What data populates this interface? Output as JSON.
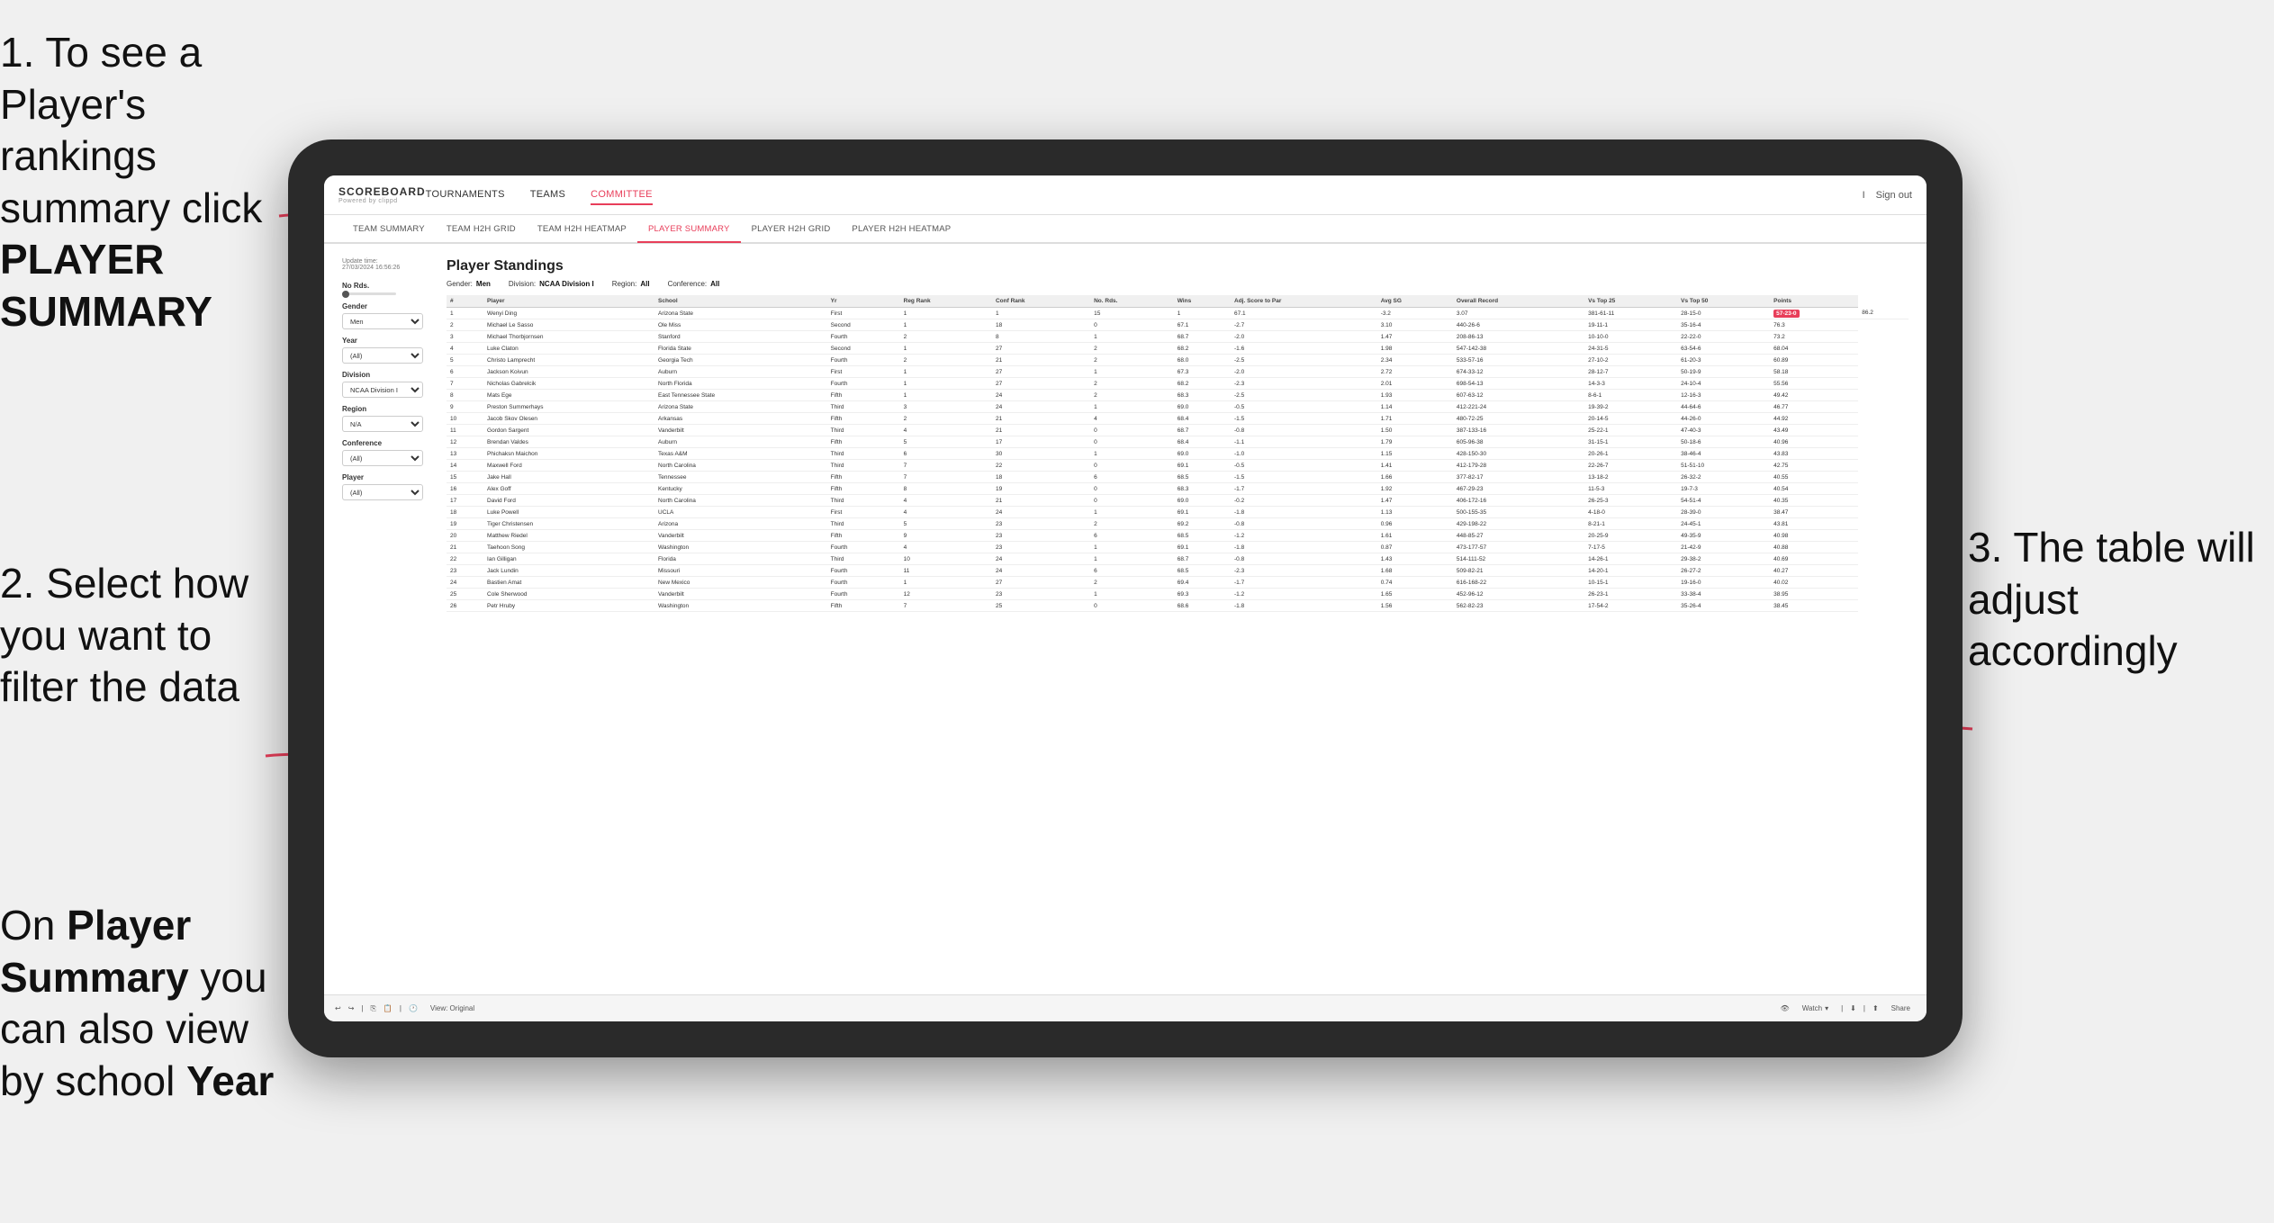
{
  "instructions": {
    "step1": "1. To see a Player's rankings summary click ",
    "step1_bold": "PLAYER SUMMARY",
    "step2_line1": "2. Select how you want to",
    "step2_line2": "filter the data",
    "step4_line1": "On ",
    "step4_bold1": "Player Summary",
    "step4_line2": " you can also view by school ",
    "step4_bold2": "Year",
    "step3_line1": "3. The table will",
    "step3_line2": "adjust accordingly"
  },
  "nav": {
    "logo": "SCOREBOARD",
    "logo_sub": "Powered by clippd",
    "items": [
      "TOURNAMENTS",
      "TEAMS",
      "COMMITTEE"
    ],
    "right_items": [
      "I",
      "Sign out"
    ]
  },
  "subnav": {
    "items": [
      "TEAM SUMMARY",
      "TEAM H2H GRID",
      "TEAM H2H HEATMAP",
      "PLAYER SUMMARY",
      "PLAYER H2H GRID",
      "PLAYER H2H HEATMAP"
    ],
    "active": "PLAYER SUMMARY"
  },
  "update_time": "Update time:\n27/03/2024 16:56:26",
  "filters": {
    "no_rds_label": "No Rds.",
    "gender_label": "Gender",
    "gender_value": "Men",
    "year_label": "Year",
    "year_value": "(All)",
    "division_label": "Division",
    "division_value": "NCAA Division I",
    "region_label": "Region",
    "region_value": "N/A",
    "conference_label": "Conference",
    "conference_value": "(All)",
    "player_label": "Player",
    "player_value": "(All)"
  },
  "table": {
    "title": "Player Standings",
    "gender": "Men",
    "division": "NCAA Division I",
    "region": "All",
    "conference": "All",
    "columns": [
      "#",
      "Player",
      "School",
      "Yr",
      "Reg Rank",
      "Conf Rank",
      "No. Rds.",
      "Wins",
      "Adj. Score to Par",
      "Avg SG",
      "Overall Record",
      "Vs Top 25",
      "Vs Top 50",
      "Points"
    ],
    "rows": [
      [
        "1",
        "Wenyi Ding",
        "Arizona State",
        "First",
        "1",
        "1",
        "15",
        "1",
        "67.1",
        "-3.2",
        "3.07",
        "381-61-11",
        "28-15-0",
        "57-23-0",
        "86.2"
      ],
      [
        "2",
        "Michael Le Sasso",
        "Ole Miss",
        "Second",
        "1",
        "18",
        "0",
        "67.1",
        "-2.7",
        "3.10",
        "440-26-6",
        "19-11-1",
        "35-16-4",
        "76.3"
      ],
      [
        "3",
        "Michael Thorbjornsen",
        "Stanford",
        "Fourth",
        "2",
        "8",
        "1",
        "68.7",
        "-2.0",
        "1.47",
        "208-86-13",
        "10-10-0",
        "22-22-0",
        "73.2"
      ],
      [
        "4",
        "Luke Claton",
        "Florida State",
        "Second",
        "1",
        "27",
        "2",
        "68.2",
        "-1.6",
        "1.98",
        "547-142-38",
        "24-31-5",
        "63-54-6",
        "68.04"
      ],
      [
        "5",
        "Christo Lamprecht",
        "Georgia Tech",
        "Fourth",
        "2",
        "21",
        "2",
        "68.0",
        "-2.5",
        "2.34",
        "533-57-16",
        "27-10-2",
        "61-20-3",
        "60.89"
      ],
      [
        "6",
        "Jackson Koivun",
        "Auburn",
        "First",
        "1",
        "27",
        "1",
        "67.3",
        "-2.0",
        "2.72",
        "674-33-12",
        "28-12-7",
        "50-19-9",
        "58.18"
      ],
      [
        "7",
        "Nicholas Gabrelcik",
        "North Florida",
        "Fourth",
        "1",
        "27",
        "2",
        "68.2",
        "-2.3",
        "2.01",
        "698-54-13",
        "14-3-3",
        "24-10-4",
        "55.56"
      ],
      [
        "8",
        "Mats Ege",
        "East Tennessee State",
        "Fifth",
        "1",
        "24",
        "2",
        "68.3",
        "-2.5",
        "1.93",
        "607-63-12",
        "8-6-1",
        "12-16-3",
        "49.42"
      ],
      [
        "9",
        "Preston Summerhays",
        "Arizona State",
        "Third",
        "3",
        "24",
        "1",
        "69.0",
        "-0.5",
        "1.14",
        "412-221-24",
        "19-39-2",
        "44-64-6",
        "46.77"
      ],
      [
        "10",
        "Jacob Skov Olesen",
        "Arkansas",
        "Fifth",
        "2",
        "21",
        "4",
        "68.4",
        "-1.5",
        "1.71",
        "480-72-25",
        "20-14-5",
        "44-26-0",
        "44.92"
      ],
      [
        "11",
        "Gordon Sargent",
        "Vanderbilt",
        "Third",
        "4",
        "21",
        "0",
        "68.7",
        "-0.8",
        "1.50",
        "387-133-16",
        "25-22-1",
        "47-40-3",
        "43.49"
      ],
      [
        "12",
        "Brendan Valdes",
        "Auburn",
        "Fifth",
        "5",
        "17",
        "0",
        "68.4",
        "-1.1",
        "1.79",
        "605-96-38",
        "31-15-1",
        "50-18-6",
        "40.96"
      ],
      [
        "13",
        "Phichaksn Maichon",
        "Texas A&M",
        "Third",
        "6",
        "30",
        "1",
        "69.0",
        "-1.0",
        "1.15",
        "428-150-30",
        "20-26-1",
        "38-46-4",
        "43.83"
      ],
      [
        "14",
        "Maxwell Ford",
        "North Carolina",
        "Third",
        "7",
        "22",
        "0",
        "69.1",
        "-0.5",
        "1.41",
        "412-179-28",
        "22-26-7",
        "51-51-10",
        "42.75"
      ],
      [
        "15",
        "Jake Hall",
        "Tennessee",
        "Fifth",
        "7",
        "18",
        "6",
        "68.5",
        "-1.5",
        "1.66",
        "377-82-17",
        "13-18-2",
        "26-32-2",
        "40.55"
      ],
      [
        "16",
        "Alex Goff",
        "Kentucky",
        "Fifth",
        "8",
        "19",
        "0",
        "68.3",
        "-1.7",
        "1.92",
        "467-29-23",
        "11-5-3",
        "19-7-3",
        "40.54"
      ],
      [
        "17",
        "David Ford",
        "North Carolina",
        "Third",
        "4",
        "21",
        "0",
        "69.0",
        "-0.2",
        "1.47",
        "406-172-16",
        "26-25-3",
        "54-51-4",
        "40.35"
      ],
      [
        "18",
        "Luke Powell",
        "UCLA",
        "First",
        "4",
        "24",
        "1",
        "69.1",
        "-1.8",
        "1.13",
        "500-155-35",
        "4-18-0",
        "28-39-0",
        "38.47"
      ],
      [
        "19",
        "Tiger Christensen",
        "Arizona",
        "Third",
        "5",
        "23",
        "2",
        "69.2",
        "-0.8",
        "0.96",
        "429-198-22",
        "8-21-1",
        "24-45-1",
        "43.81"
      ],
      [
        "20",
        "Matthew Riedel",
        "Vanderbilt",
        "Fifth",
        "9",
        "23",
        "6",
        "68.5",
        "-1.2",
        "1.61",
        "448-85-27",
        "20-25-9",
        "49-35-9",
        "40.98"
      ],
      [
        "21",
        "Taehoon Song",
        "Washington",
        "Fourth",
        "4",
        "23",
        "1",
        "69.1",
        "-1.8",
        "0.87",
        "473-177-57",
        "7-17-5",
        "21-42-9",
        "40.88"
      ],
      [
        "22",
        "Ian Gilligan",
        "Florida",
        "Third",
        "10",
        "24",
        "1",
        "68.7",
        "-0.8",
        "1.43",
        "514-111-52",
        "14-26-1",
        "29-38-2",
        "40.69"
      ],
      [
        "23",
        "Jack Lundin",
        "Missouri",
        "Fourth",
        "11",
        "24",
        "6",
        "68.5",
        "-2.3",
        "1.68",
        "509-82-21",
        "14-20-1",
        "26-27-2",
        "40.27"
      ],
      [
        "24",
        "Bastien Amat",
        "New Mexico",
        "Fourth",
        "1",
        "27",
        "2",
        "69.4",
        "-1.7",
        "0.74",
        "616-168-22",
        "10-15-1",
        "19-16-0",
        "40.02"
      ],
      [
        "25",
        "Cole Sherwood",
        "Vanderbilt",
        "Fourth",
        "12",
        "23",
        "1",
        "69.3",
        "-1.2",
        "1.65",
        "452-96-12",
        "26-23-1",
        "33-38-4",
        "38.95"
      ],
      [
        "26",
        "Petr Hruby",
        "Washington",
        "Fifth",
        "7",
        "25",
        "0",
        "68.6",
        "-1.8",
        "1.56",
        "562-82-23",
        "17-54-2",
        "35-26-4",
        "38.45"
      ]
    ]
  },
  "toolbar": {
    "view_original": "View: Original",
    "watch": "Watch",
    "share": "Share"
  },
  "colors": {
    "accent": "#e83e5a",
    "nav_border": "#dddddd",
    "bg_light": "#f5f5f5"
  }
}
